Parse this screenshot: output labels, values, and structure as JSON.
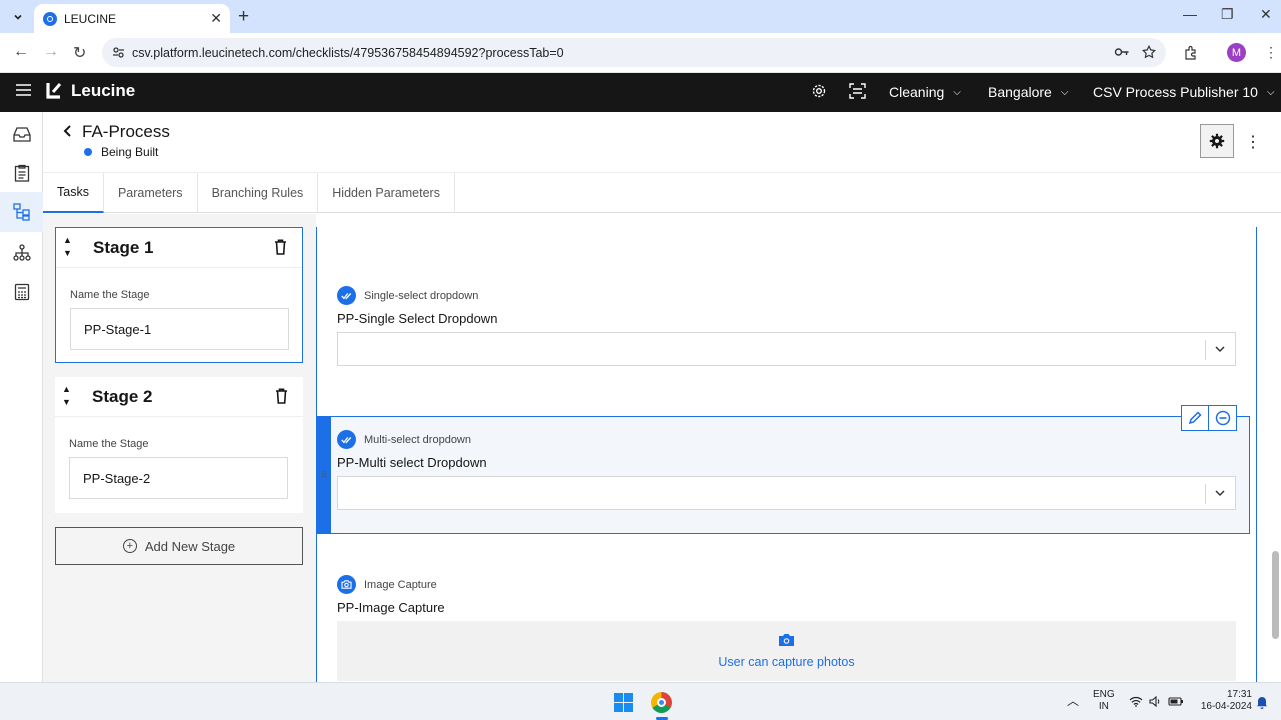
{
  "browser": {
    "tab_title": "LEUCINE",
    "url": "csv.platform.leucinetech.com/checklists/479536758454894592?processTab=0",
    "profile_initial": "M"
  },
  "appbar": {
    "brand": "Leucine",
    "selectors": [
      {
        "label": "Cleaning"
      },
      {
        "label": "Bangalore"
      },
      {
        "label": "CSV Process Publisher 10"
      }
    ]
  },
  "process": {
    "title": "FA-Process",
    "status": "Being Built"
  },
  "tabs": [
    "Tasks",
    "Parameters",
    "Branching Rules",
    "Hidden Parameters"
  ],
  "stages": [
    {
      "title": "Stage 1",
      "field_label": "Name the Stage",
      "value": "PP-Stage-1"
    },
    {
      "title": "Stage 2",
      "field_label": "Name the Stage",
      "value": "PP-Stage-2"
    }
  ],
  "add_stage_label": "Add New Stage",
  "parameters": [
    {
      "type_label": "Single-select dropdown",
      "name": "PP-Single Select Dropdown"
    },
    {
      "type_label": "Multi-select dropdown",
      "name": "PP-Multi select Dropdown"
    },
    {
      "type_label": "Image Capture",
      "name": "PP-Image Capture",
      "capture_text": "User can capture photos"
    }
  ],
  "taskbar": {
    "lang_line1": "ENG",
    "lang_line2": "IN",
    "time": "17:31",
    "date": "16-04-2024"
  },
  "colors": {
    "accent": "#1d6fe7",
    "header_bg": "#161616",
    "chrome_tabbar": "#d3e3fd"
  }
}
